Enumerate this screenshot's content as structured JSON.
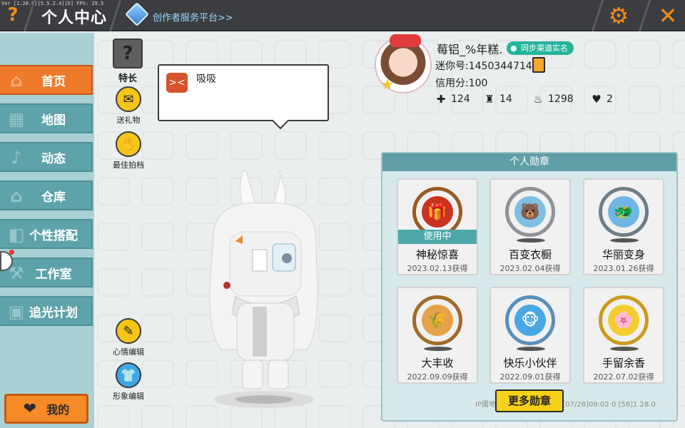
{
  "debug_text": "Ver [1.28.0][5.5.2.4][D] FPS: 29.5",
  "header": {
    "title": "个人中心",
    "creator_link": "创作者服务平台>>",
    "help_symbol": "?",
    "close_symbol": "✕",
    "settings_symbol": "⚙"
  },
  "sidebar": {
    "items": [
      {
        "label": "首页",
        "icon": "home-icon",
        "glyph": "⌂"
      },
      {
        "label": "地图",
        "icon": "map-icon",
        "glyph": "▦"
      },
      {
        "label": "动态",
        "icon": "bell-icon",
        "glyph": "♪"
      },
      {
        "label": "仓库",
        "icon": "warehouse-icon",
        "glyph": "⌂"
      },
      {
        "label": "个性搭配",
        "icon": "outfit-icon",
        "glyph": "◧"
      },
      {
        "label": "工作室",
        "icon": "studio-icon",
        "glyph": "⚒"
      },
      {
        "label": "追光计划",
        "icon": "camera-icon",
        "glyph": "▣"
      }
    ],
    "active_index": 0,
    "mine_button": "我的"
  },
  "actions": {
    "specialty": {
      "label": "特长",
      "glyph": "?"
    },
    "gift": {
      "label": "送礼物",
      "glyph": "✉"
    },
    "partner": {
      "label": "最佳拍档",
      "glyph": "✋"
    },
    "mood_edit": {
      "label": "心情编辑",
      "glyph": "✎"
    },
    "avatar_edit": {
      "label": "形象编辑",
      "glyph": "👕"
    }
  },
  "bubble": {
    "mood_glyph": "><",
    "text": "吸吸"
  },
  "profile": {
    "name": "莓铝_%年糕.",
    "realname_badge": "同步渠道实名",
    "uid": "迷你号:1450344714",
    "credit": "信用分:100",
    "stats": [
      {
        "icon": "plus-icon",
        "glyph": "✚",
        "value": "124"
      },
      {
        "icon": "fans-icon",
        "glyph": "♜",
        "value": "14"
      },
      {
        "icon": "fire-icon",
        "glyph": "♨",
        "value": "1298"
      },
      {
        "icon": "hearts-icon",
        "glyph": "♥",
        "value": "2"
      }
    ]
  },
  "badges": {
    "title": "个人勋章",
    "in_use_label": "使用中",
    "items": [
      {
        "name": "神秘惊喜",
        "date": "2023.02.13获得",
        "in_use": true,
        "ring": "#9b5a22",
        "fill": "#c9321f",
        "glyph": "🎁"
      },
      {
        "name": "百变衣橱",
        "date": "2023.02.04获得",
        "in_use": false,
        "ring": "#8f9296",
        "fill": "#7fbfe0",
        "glyph": "🐻"
      },
      {
        "name": "华丽变身",
        "date": "2023.01.26获得",
        "in_use": false,
        "ring": "#6d7d88",
        "fill": "#6fb7e2",
        "glyph": "🐲"
      },
      {
        "name": "大丰收",
        "date": "2022.09.09获得",
        "in_use": false,
        "ring": "#a06a2a",
        "fill": "#e5a24a",
        "glyph": "🌾"
      },
      {
        "name": "快乐小伙伴",
        "date": "2022.09.01获得",
        "in_use": false,
        "ring": "#5a8fb8",
        "fill": "#4aa7e6",
        "glyph": "🐵"
      },
      {
        "name": "手留余香",
        "date": "2022.07.02获得",
        "in_use": false,
        "ring": "#c99b1e",
        "fill": "#f3cd2f",
        "glyph": "🌸"
      }
    ],
    "more_button": "更多勋章"
  },
  "footer_ip": "IP属地:未知  1450344714    [07/28]09:02 0    [58]1.28.0"
}
